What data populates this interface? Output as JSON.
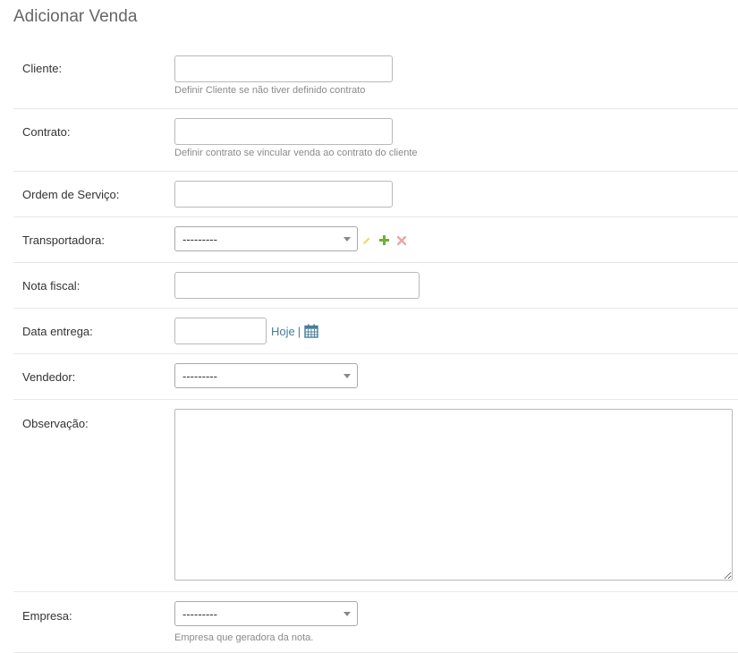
{
  "page": {
    "title": "Adicionar Venda"
  },
  "fields": {
    "cliente": {
      "label": "Cliente:",
      "value": "",
      "help": "Definir Cliente se não tiver definido contrato"
    },
    "contrato": {
      "label": "Contrato:",
      "value": "",
      "help": "Definir contrato se vincular venda ao contrato do cliente"
    },
    "ordem_servico": {
      "label": "Ordem de Serviço:",
      "value": ""
    },
    "transportadora": {
      "label": "Transportadora:",
      "selected": "---------",
      "icons": [
        "pencil-icon",
        "plus-icon",
        "close-icon"
      ]
    },
    "nota_fiscal": {
      "label": "Nota fiscal:",
      "value": ""
    },
    "data_entrega": {
      "label": "Data entrega:",
      "value": "",
      "today_link": "Hoje",
      "separator": "|",
      "icon": "calendar-icon"
    },
    "vendedor": {
      "label": "Vendedor:",
      "selected": "---------"
    },
    "observacao": {
      "label": "Observação:",
      "value": ""
    },
    "empresa": {
      "label": "Empresa:",
      "selected": "---------",
      "help": "Empresa que geradora da nota."
    }
  },
  "colors": {
    "pencil": "#e6d96b",
    "plus": "#6bb13c",
    "close": "#e8a8a8",
    "link": "#447e9b",
    "calendar": "#447e9b"
  }
}
